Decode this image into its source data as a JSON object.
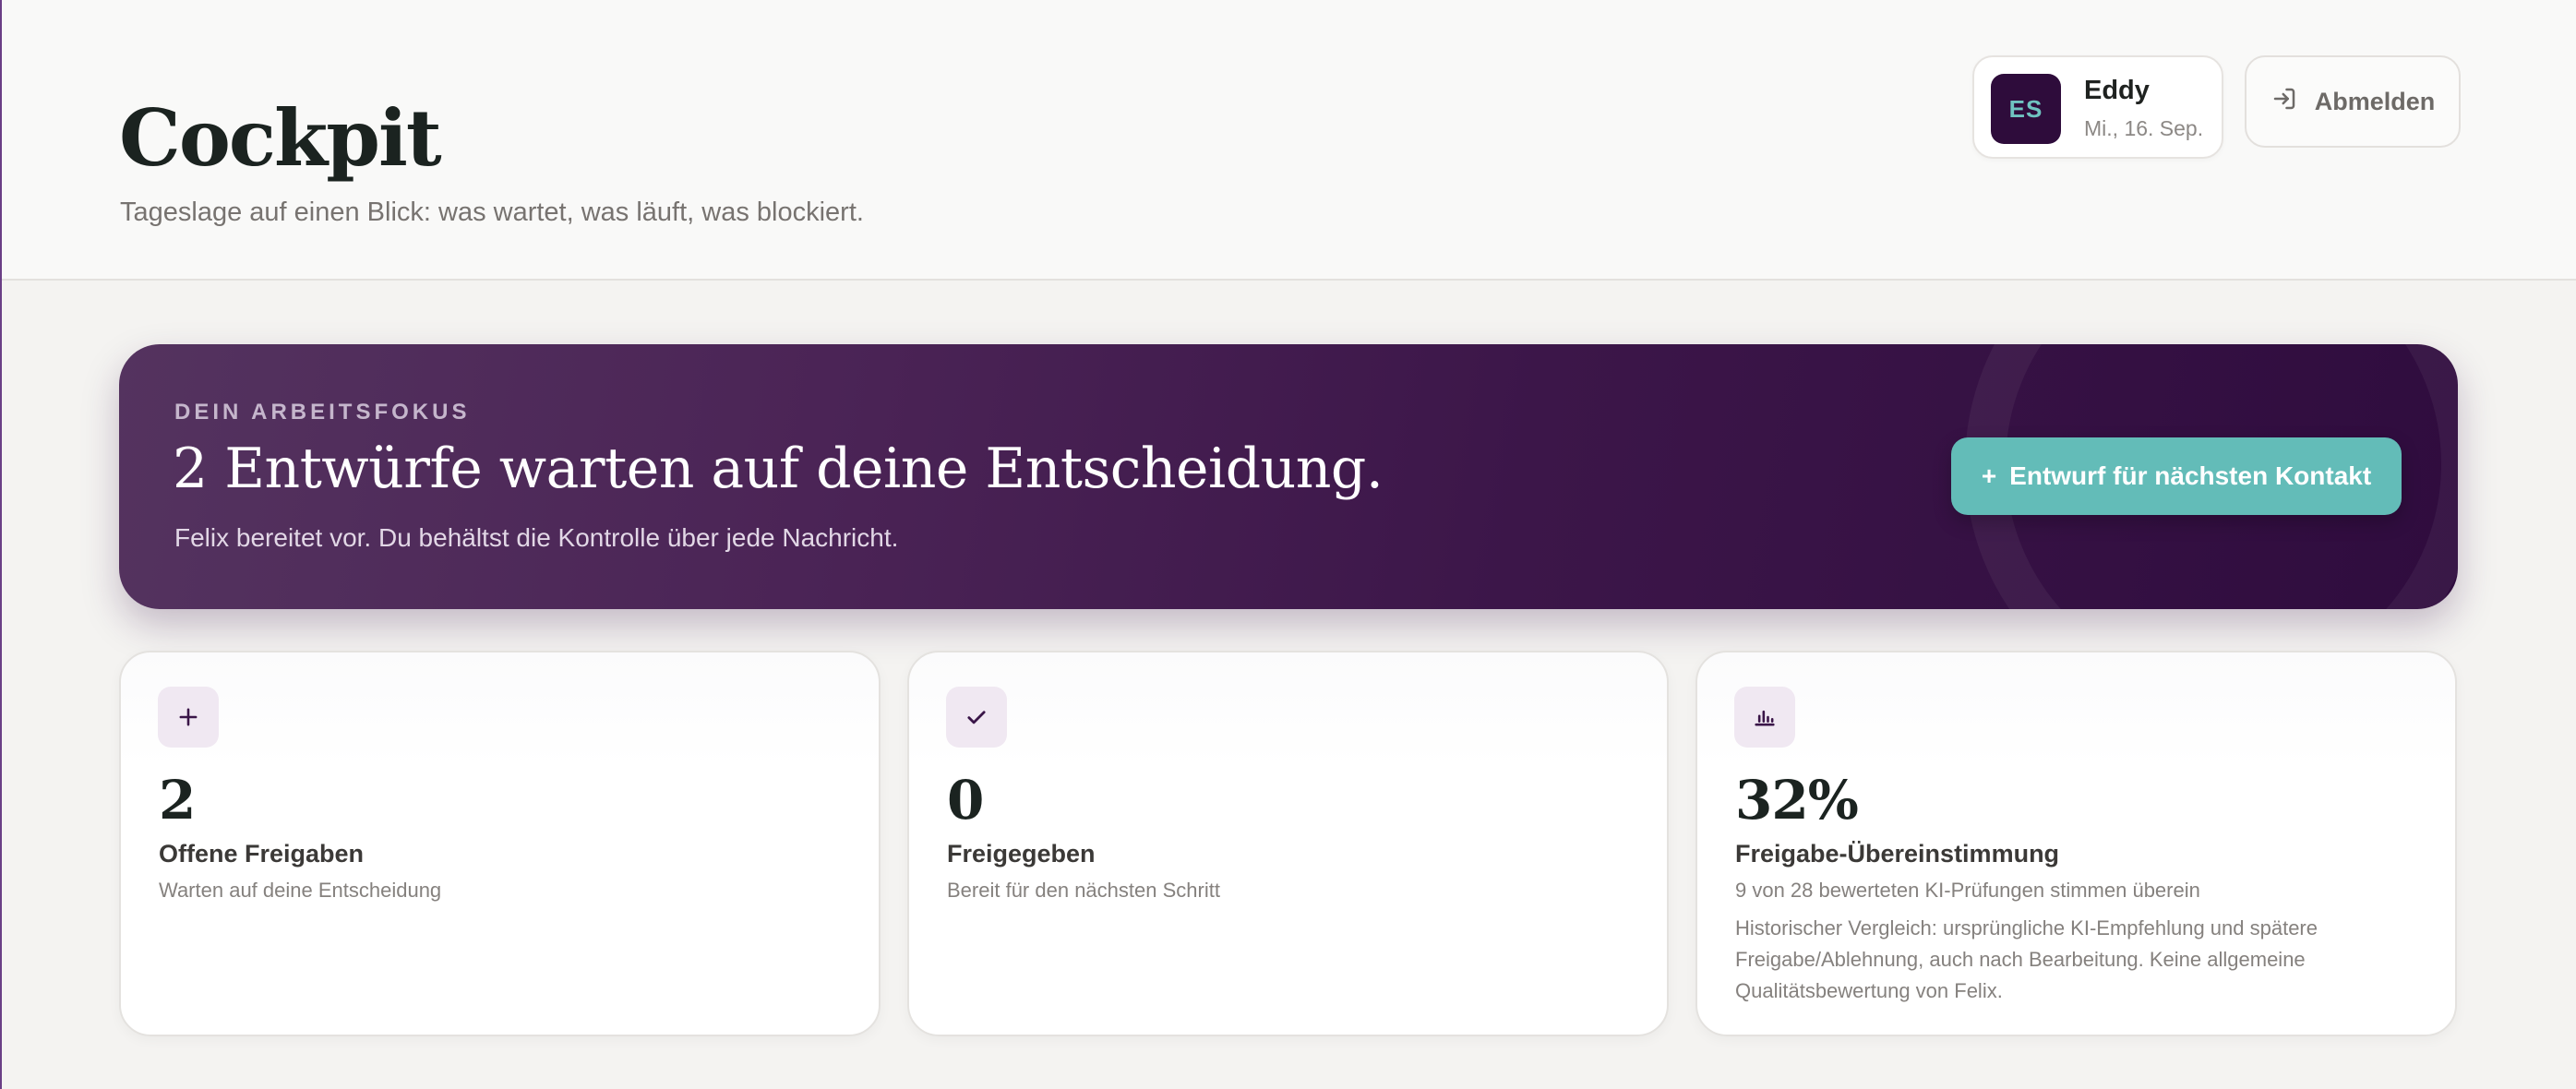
{
  "header": {
    "title": "Cockpit",
    "subtitle": "Tageslage auf einen Blick: was wartet, was läuft, was blockiert."
  },
  "user": {
    "initials": "ES",
    "name": "Eddy",
    "date": "Mi., 16. Sep."
  },
  "logout": {
    "label": "Abmelden",
    "icon": "logout-icon"
  },
  "hero": {
    "kicker": "DEIN ARBEITSFOKUS",
    "title": "2 Entwürfe warten auf deine Entscheidung.",
    "subtitle": "Felix bereitet vor. Du behältst die Kontrolle über jede Nachricht.",
    "cta_icon": "+",
    "cta_label": "Entwurf für nächsten Kontakt"
  },
  "stats": [
    {
      "icon": "plus-icon",
      "value": "2",
      "label": "Offene Freigaben",
      "sub": "Warten auf deine Entscheidung"
    },
    {
      "icon": "check-icon",
      "value": "0",
      "label": "Freigegeben",
      "sub": "Bereit für den nächsten Schritt"
    },
    {
      "icon": "bar-chart-icon",
      "value": "32%",
      "label": "Freigabe-Übereinstimmung",
      "sub": "9 von 28 bewerteten KI-Prüfungen stimmen überein",
      "note": "Historischer Vergleich: ursprüngliche KI-Empfehlung und spätere Freigabe/Ablehnung, auch nach Bearbeitung. Keine allgemeine Qualitätsbewertung von Felix."
    }
  ],
  "colors": {
    "accent_purple": "#2e0c3b",
    "accent_teal": "#63bcb8",
    "icon_bg": "#f0e8f2"
  }
}
